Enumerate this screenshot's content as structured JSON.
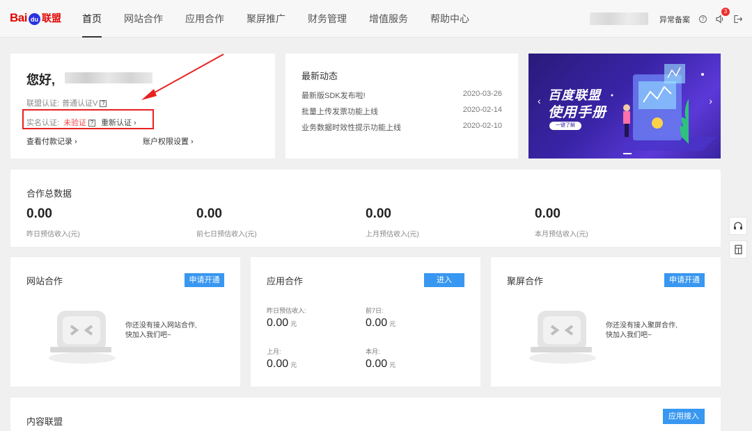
{
  "header": {
    "logo_bai": "Bai",
    "logo_du": "du",
    "logo_lm": "联盟",
    "nav": [
      {
        "label": "首页",
        "active": true
      },
      {
        "label": "网站合作",
        "active": false
      },
      {
        "label": "应用合作",
        "active": false
      },
      {
        "label": "聚屏推广",
        "active": false
      },
      {
        "label": "财务管理",
        "active": false
      },
      {
        "label": "增值服务",
        "active": false
      },
      {
        "label": "帮助中心",
        "active": false
      }
    ],
    "link_record": "异常备案",
    "notification_count": "3"
  },
  "welcome": {
    "greeting": "您好,",
    "cert_label": "联盟认证:",
    "cert_value": "普通认证V",
    "realname_label": "实名认证:",
    "realname_value": "未验证",
    "reverify": "重新认证 ›",
    "payment_records": "查看付款记录 ›",
    "account_settings": "账户权限设置 ›",
    "q": "?"
  },
  "news": {
    "title": "最新动态",
    "items": [
      {
        "text": "最新版SDK发布啦!",
        "date": "2020-03-26"
      },
      {
        "text": "批量上传发票功能上线",
        "date": "2020-02-14"
      },
      {
        "text": "业务数据时效性提示功能上线",
        "date": "2020-02-10"
      }
    ]
  },
  "banner": {
    "line1": "百度联盟",
    "line2": "使用手册",
    "button": "一键了解",
    "prev": "‹",
    "next": "›"
  },
  "totals": {
    "title": "合作总数据",
    "items": [
      {
        "value": "0.00",
        "label": "昨日预估收入(元)"
      },
      {
        "value": "0.00",
        "label": "前七日预估收入(元)"
      },
      {
        "value": "0.00",
        "label": "上月预估收入(元)"
      },
      {
        "value": "0.00",
        "label": "本月预估收入(元)"
      }
    ]
  },
  "site_coop": {
    "title": "网站合作",
    "button": "申请开通",
    "empty_line1": "你还没有接入网站合作,",
    "empty_line2": "快加入我们吧~"
  },
  "app_coop": {
    "title": "应用合作",
    "button": "进入",
    "stats": [
      {
        "label": "昨日预估收入:",
        "value": "0.00",
        "unit": "元"
      },
      {
        "label": "前7日:",
        "value": "0.00",
        "unit": "元"
      },
      {
        "label": "上月:",
        "value": "0.00",
        "unit": "元"
      },
      {
        "label": "本月:",
        "value": "0.00",
        "unit": "元"
      }
    ]
  },
  "screen_coop": {
    "title": "聚屏合作",
    "button": "申请开通",
    "empty_line1": "你还没有接入聚屏合作,",
    "empty_line2": "快加入我们吧~"
  },
  "content_coop": {
    "title": "内容联盟",
    "button": "应用接入"
  },
  "colors": {
    "accent": "#3897f0",
    "danger": "#f04848",
    "highlight_box": "#e82121"
  }
}
